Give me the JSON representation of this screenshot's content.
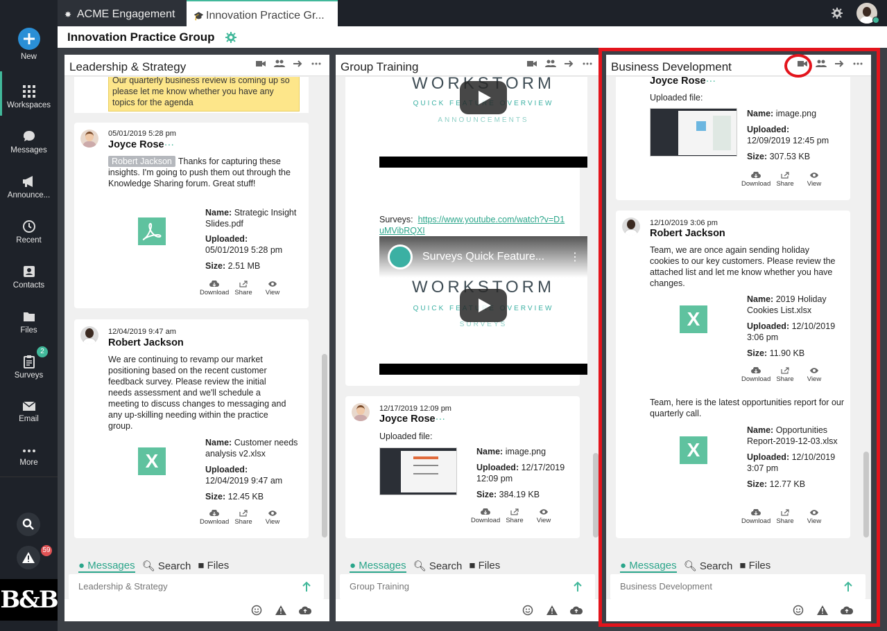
{
  "app": {
    "tabs": [
      {
        "label": "ACME Engagement",
        "active": false
      },
      {
        "label": "Innovation Practice Gr...",
        "active": true
      }
    ],
    "page_title": "Innovation Practice Group",
    "accent_color": "#41b89a",
    "highlight_color": "#e3141c"
  },
  "sidebar": {
    "items": [
      {
        "label": "New",
        "icon": "plus-circle-icon"
      },
      {
        "label": "Workspaces",
        "icon": "grid-icon"
      },
      {
        "label": "Messages",
        "icon": "chat-bubble-icon"
      },
      {
        "label": "Announce...",
        "icon": "megaphone-icon"
      },
      {
        "label": "Recent",
        "icon": "clock-icon"
      },
      {
        "label": "Contacts",
        "icon": "contact-card-icon"
      },
      {
        "label": "Files",
        "icon": "folder-icon"
      },
      {
        "label": "Surveys",
        "icon": "clipboard-icon",
        "badge": "2"
      },
      {
        "label": "Email",
        "icon": "envelope-icon"
      },
      {
        "label": "More",
        "icon": "ellipsis-icon"
      }
    ],
    "alert_badge": "59",
    "logo_text": "B&B"
  },
  "columns": [
    {
      "title": "Leadership & Strategy",
      "compose_placeholder": "Leadership & Strategy",
      "footer_tabs": [
        "Messages",
        "Search",
        "Files"
      ],
      "sticky_note": "Our quarterly business review is coming up so please let me know whether you have any topics for the agenda",
      "posts": [
        {
          "date": "05/01/2019 5:28 pm",
          "author": "Joyce Rose",
          "mention": "Robert Jackson",
          "text": "Thanks for capturing these insights.  I'm going to push them out through the Knowledge Sharing forum. Great stuff!",
          "file": {
            "name_label": "Name:",
            "name": "Strategic Insight Slides.pdf",
            "uploaded_label": "Uploaded:",
            "uploaded": "05/01/2019 5:28 pm",
            "size_label": "Size:",
            "size": "2.51 MB",
            "type": "pdf"
          },
          "actions": [
            "Download",
            "Share",
            "View"
          ]
        },
        {
          "date": "12/04/2019 9:47 am",
          "author": "Robert Jackson",
          "text": "We are continuing to revamp our market positioning based on the recent customer feedback survey. Please review the initial needs assessment and we'll schedule a meeting to discuss changes to messaging and any up-skilling needing within the practice group.",
          "file": {
            "name_label": "Name:",
            "name": "Customer needs analysis v2.xlsx",
            "uploaded_label": "Uploaded:",
            "uploaded": "12/04/2019 9:47 am",
            "size_label": "Size:",
            "size": "12.45 KB",
            "type": "xlsx"
          },
          "actions": [
            "Download",
            "Share",
            "View"
          ]
        }
      ]
    },
    {
      "title": "Group Training",
      "compose_placeholder": "Group Training",
      "footer_tabs": [
        "Messages",
        "Search",
        "Files"
      ],
      "video1": {
        "brand": "WORKSTORM",
        "subtitle": "QUICK FEATURE OVERVIEW",
        "section": "ANNOUNCEMENTS"
      },
      "surveys_label": "Surveys:",
      "surveys_link": "https://www.youtube.com/watch?v=D1uMVibRQXI",
      "video2": {
        "title": "Surveys Quick Feature...",
        "brand": "WORKSTORM",
        "subtitle": "QUICK FEATURE OVERVIEW",
        "section": "SURVEYS"
      },
      "posts": [
        {
          "date": "12/17/2019 12:09 pm",
          "author": "Joyce Rose",
          "text": "Uploaded file:",
          "file": {
            "name_label": "Name:",
            "name": "image.png",
            "uploaded_label": "Uploaded:",
            "uploaded": "12/17/2019 12:09 pm",
            "size_label": "Size:",
            "size": "384.19 KB",
            "type": "image"
          },
          "actions": [
            "Download",
            "Share",
            "View"
          ]
        }
      ]
    },
    {
      "title": "Business Development",
      "compose_placeholder": "Business Development",
      "footer_tabs": [
        "Messages",
        "Search",
        "Files"
      ],
      "posts": [
        {
          "author": "Joyce Rose",
          "text": "Uploaded file:",
          "file": {
            "name_label": "Name:",
            "name": "image.png",
            "uploaded_label": "Uploaded:",
            "uploaded": "12/09/2019 12:45 pm",
            "size_label": "Size:",
            "size": "307.53 KB",
            "type": "image"
          },
          "actions": [
            "Download",
            "Share",
            "View"
          ]
        },
        {
          "date": "12/10/2019 3:06 pm",
          "author": "Robert Jackson",
          "text": "Team, we are once again sending holiday cookies to our key customers. Please review the attached list and let me know whether you have changes.",
          "file": {
            "name_label": "Name:",
            "name": "2019 Holiday Cookies List.xlsx",
            "uploaded_label": "Uploaded:",
            "uploaded": "12/10/2019 3:06 pm",
            "size_label": "Size:",
            "size": "11.90 KB",
            "type": "xlsx"
          },
          "text2": "Team, here is the latest opportunities report for our quarterly call.",
          "file2": {
            "name_label": "Name:",
            "name": "Opportunities Report-2019-12-03.xlsx",
            "uploaded_label": "Uploaded:",
            "uploaded": "12/10/2019 3:07 pm",
            "size_label": "Size:",
            "size": "12.77 KB",
            "type": "xlsx"
          },
          "actions": [
            "Download",
            "Share",
            "View"
          ]
        }
      ]
    }
  ]
}
